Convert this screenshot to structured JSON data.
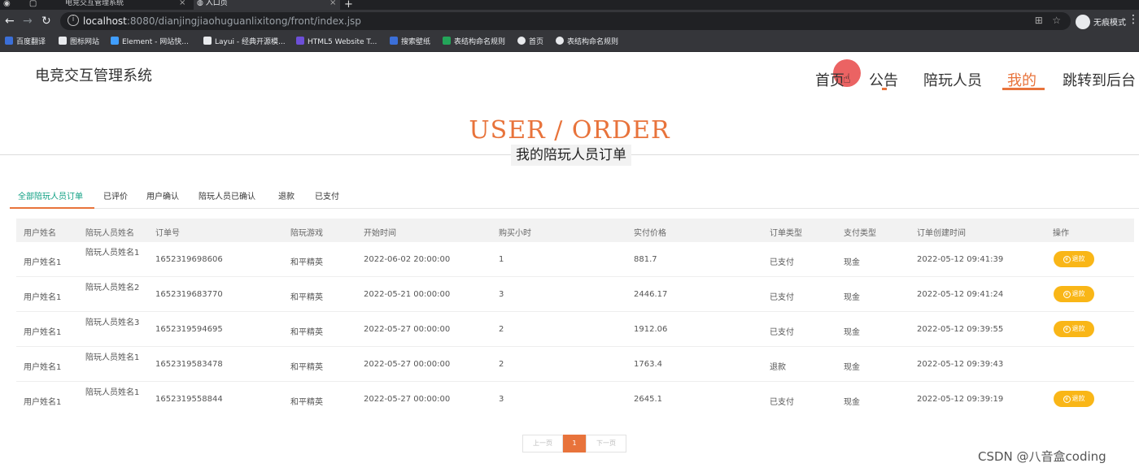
{
  "browser": {
    "tabs": [
      {
        "label": "电竞交互管理系统"
      },
      {
        "label": "入口页"
      }
    ],
    "url_host": "localhost",
    "url_path": ":8080/dianjingjiaohuguanlixitong/front/index.jsp",
    "incognito_label": "无痕模式",
    "bookmarks": [
      {
        "label": "百度翻译",
        "icon": "baidu-translate-icon",
        "color": "#3b6fd8"
      },
      {
        "label": "图标网站",
        "icon": "flag-icon",
        "color": "#e8eaed"
      },
      {
        "label": "Element - 网站快...",
        "icon": "element-icon",
        "color": "#409eff"
      },
      {
        "label": "Layui - 经典开源模...",
        "icon": "layui-icon",
        "color": "#e8eaed"
      },
      {
        "label": "HTML5 Website T...",
        "icon": "html5-icon",
        "color": "#6d4fd8"
      },
      {
        "label": "搜索壁纸",
        "icon": "wallpaper-icon",
        "color": "#3b6fd8"
      },
      {
        "label": "表结构命名规则",
        "icon": "doc-icon",
        "color": "#23a559"
      },
      {
        "label": "首页",
        "icon": "globe-icon",
        "color": "#e8eaed"
      },
      {
        "label": "表结构命名规则",
        "icon": "globe-icon",
        "color": "#e8eaed"
      }
    ]
  },
  "site": {
    "logo": "电竞交互管理系统",
    "nav": [
      {
        "label": "首页"
      },
      {
        "label": "公告"
      },
      {
        "label": "陪玩人员"
      },
      {
        "label": "我的"
      },
      {
        "label": "跳转到后台"
      }
    ],
    "accent_color": "#e8733b"
  },
  "hero": {
    "title": "USER / ORDER",
    "subtitle": "我的陪玩人员订单"
  },
  "order_tabs": [
    {
      "label": "全部陪玩人员订单"
    },
    {
      "label": "已评价"
    },
    {
      "label": "用户确认"
    },
    {
      "label": "陪玩人员已确认"
    },
    {
      "label": "退款"
    },
    {
      "label": "已支付"
    }
  ],
  "table": {
    "headers": [
      "用户姓名",
      "陪玩人员姓名",
      "订单号",
      "陪玩游戏",
      "开始时间",
      "购买小时",
      "实付价格",
      "订单类型",
      "支付类型",
      "订单创建时间",
      "操作"
    ],
    "rows": [
      {
        "user": "用户姓名1",
        "companion": "陪玩人员姓名1",
        "order_no": "1652319698606",
        "game": "和平精英",
        "start": "2022-06-02 20:00:00",
        "hours": "1",
        "price": "881.7",
        "order_type": "已支付",
        "pay_type": "现金",
        "created": "2022-05-12 09:41:39",
        "action": "退款"
      },
      {
        "user": "用户姓名1",
        "companion": "陪玩人员姓名2",
        "order_no": "1652319683770",
        "game": "和平精英",
        "start": "2022-05-21 00:00:00",
        "hours": "3",
        "price": "2446.17",
        "order_type": "已支付",
        "pay_type": "现金",
        "created": "2022-05-12 09:41:24",
        "action": "退款"
      },
      {
        "user": "用户姓名1",
        "companion": "陪玩人员姓名3",
        "order_no": "1652319594695",
        "game": "和平精英",
        "start": "2022-05-27 00:00:00",
        "hours": "2",
        "price": "1912.06",
        "order_type": "已支付",
        "pay_type": "现金",
        "created": "2022-05-12 09:39:55",
        "action": "退款"
      },
      {
        "user": "用户姓名1",
        "companion": "陪玩人员姓名1",
        "order_no": "1652319583478",
        "game": "和平精英",
        "start": "2022-05-27 00:00:00",
        "hours": "2",
        "price": "1763.4",
        "order_type": "退款",
        "pay_type": "现金",
        "created": "2022-05-12 09:39:43",
        "action": ""
      },
      {
        "user": "用户姓名1",
        "companion": "陪玩人员姓名1",
        "order_no": "1652319558844",
        "game": "和平精英",
        "start": "2022-05-27 00:00:00",
        "hours": "3",
        "price": "2645.1",
        "order_type": "已支付",
        "pay_type": "现金",
        "created": "2022-05-12 09:39:19",
        "action": "退款"
      }
    ]
  },
  "pagination": {
    "prev": "上一页",
    "current": "1",
    "next": "下一页"
  },
  "watermark": "CSDN @八音盒coding"
}
